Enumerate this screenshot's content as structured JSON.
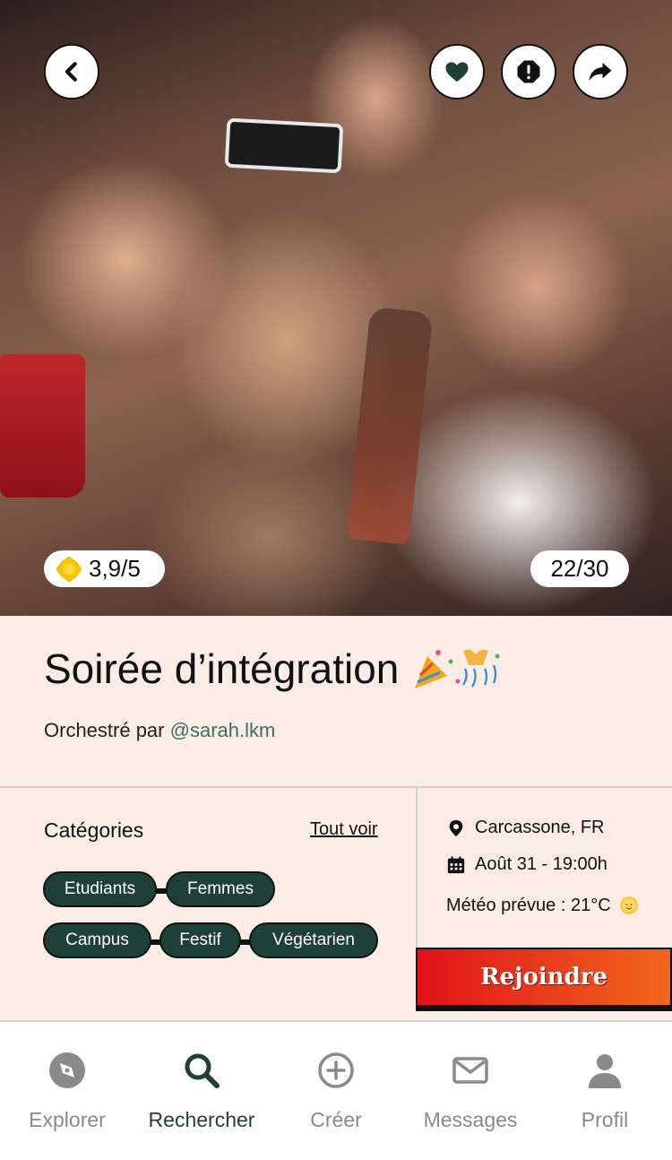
{
  "hero": {
    "rating": "3,9/5",
    "attendance": "22/30",
    "icons": {
      "back": "chevron-left-icon",
      "favorite": "heart-icon",
      "report": "alert-octagon-icon",
      "share": "share-arrow-icon",
      "rating": "sun-flower-icon"
    }
  },
  "event": {
    "title": "Soirée d’intégration",
    "organizer_prefix": "Orchestré par",
    "organizer_handle": "@sarah.lkm",
    "categories_title": "Catégories",
    "see_all": "Tout voir",
    "tags": [
      "Etudiants",
      "Femmes",
      "Campus",
      "Festif",
      "Végétarien"
    ],
    "location": "Carcassone, FR",
    "datetime": "Août 31 - 19:00h",
    "weather": "Météo prévue : 21°C",
    "join_label": "Rejoindre"
  },
  "nav": {
    "items": [
      {
        "label": "Explorer",
        "icon": "compass-icon"
      },
      {
        "label": "Rechercher",
        "icon": "search-icon"
      },
      {
        "label": "Créer",
        "icon": "plus-circle-icon"
      },
      {
        "label": "Messages",
        "icon": "mail-icon"
      },
      {
        "label": "Profil",
        "icon": "user-icon"
      }
    ],
    "active": "Rechercher"
  },
  "colors": {
    "accent_dark_green": "#1f3f39",
    "link_teal": "#3e6e6a",
    "panel_bg": "#fbede6",
    "join_gradient_start": "#e0121a",
    "join_gradient_end": "#f1671a",
    "nav_inactive": "#8a8a8a"
  }
}
